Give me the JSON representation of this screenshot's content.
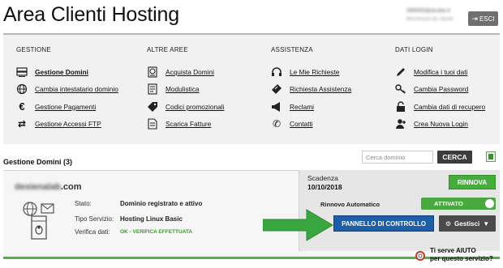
{
  "header": {
    "title": "Area Clienti Hosting",
    "user_line1": "086993@aruba.it",
    "user_line2": "MAURIZIO DE GENA",
    "exit_label": "ESCI"
  },
  "menu": {
    "gestione": {
      "heading": "GESTIONE",
      "items": [
        {
          "label": "Gestione Domini",
          "icon": "server-icon"
        },
        {
          "label": "Cambia intestatario dominio",
          "icon": "globe-icon"
        },
        {
          "label": "Gestione Pagamenti",
          "icon": "euro-icon"
        },
        {
          "label": "Gestione Accessi FTP",
          "icon": "transfer-arrows-icon"
        }
      ]
    },
    "altre_aree": {
      "heading": "ALTRE AREE",
      "items": [
        {
          "label": "Acquista Domini",
          "icon": "globe-document-icon"
        },
        {
          "label": "Modulistica",
          "icon": "form-icon"
        },
        {
          "label": "Codici promozionali",
          "icon": "tag-icon"
        },
        {
          "label": "Scarica Fatture",
          "icon": "invoice-icon"
        }
      ]
    },
    "assistenza": {
      "heading": "ASSISTENZA",
      "items": [
        {
          "label": "Le Mie Richieste",
          "icon": "headset-icon"
        },
        {
          "label": "Richiesta Assistenza",
          "icon": "ticket-icon"
        },
        {
          "label": "Reclami",
          "icon": "megaphone-icon"
        },
        {
          "label": "Contatti",
          "icon": "phone-icon"
        }
      ]
    },
    "dati_login": {
      "heading": "DATI LOGIN",
      "items": [
        {
          "label": "Modifica i tuoi dati",
          "icon": "pencil-icon"
        },
        {
          "label": "Cambia Password",
          "icon": "key-icon"
        },
        {
          "label": "Cambia dati di recupero",
          "icon": "padlock-icon"
        },
        {
          "label": "Crea Nuova Login",
          "icon": "add-user-icon"
        }
      ]
    }
  },
  "domains_section": {
    "title": "Gestione Domini (3)",
    "search_placeholder": "Cerca dominio",
    "search_button": "CERCA"
  },
  "domain": {
    "name_hidden": "desienalab",
    "name_tld": ".com",
    "status_label": "Stato:",
    "status_value": "Dominio registrato e attivo",
    "service_label": "Tipo Servizio:",
    "service_value": "Hosting Linux Basic",
    "verify_label": "Verifica dati:",
    "verify_value": "OK - VERIFICA EFFETTUATA",
    "expiry_label": "Scadenza",
    "expiry_date": "10/10/2018",
    "renew_label": "RINNOVA",
    "auto_renew_label": "Rinnovo Automatico",
    "auto_renew_state": "ATTIVATO",
    "control_panel_label": "PANNELLO DI CONTROLLO",
    "manage_label": "Gestisci"
  },
  "help": {
    "line1": "Ti serve AIUTO",
    "line2": "per questo servizio?"
  },
  "colors": {
    "green": "#45ad3c",
    "blue": "#1d5ea6",
    "dark": "#3c3c3c"
  }
}
